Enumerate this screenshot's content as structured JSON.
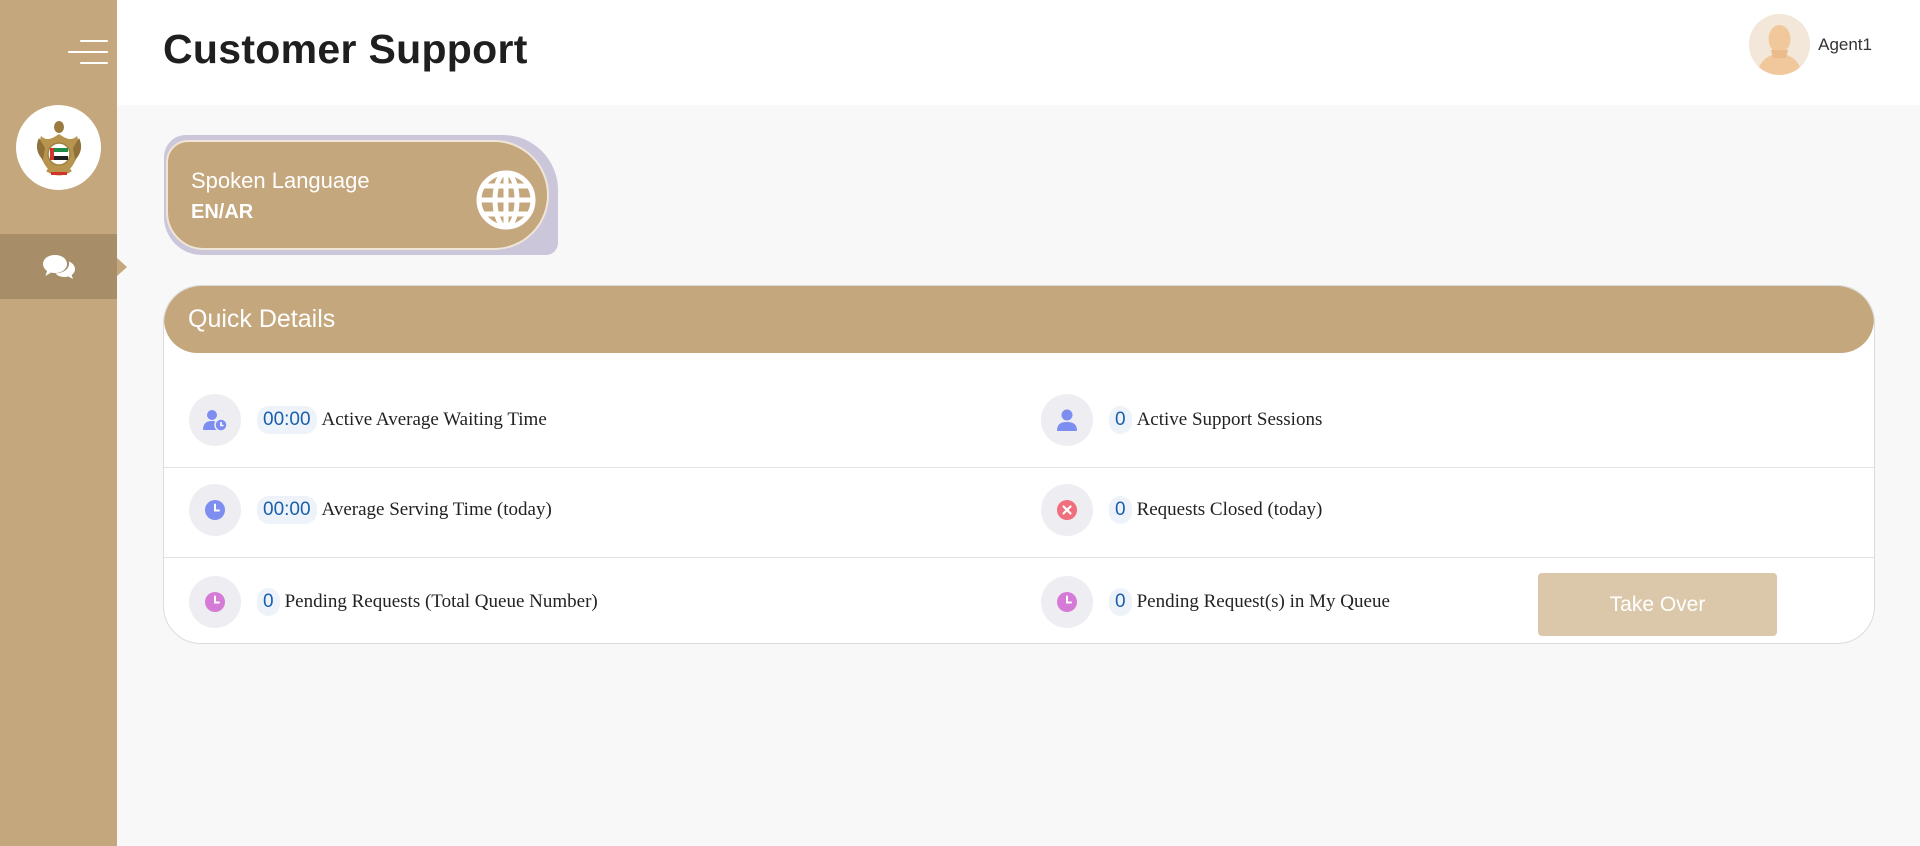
{
  "header": {
    "title": "Customer Support",
    "user_name": "Agent1"
  },
  "sidebar": {
    "items": [
      {
        "icon": "chat-bubbles-icon",
        "active": true
      }
    ]
  },
  "language_card": {
    "label": "Spoken Language",
    "value": "EN/AR"
  },
  "quick_details": {
    "title": "Quick Details",
    "stats": [
      {
        "value": "00:00",
        "label": "Active Average Waiting Time",
        "icon": "user-clock-icon",
        "icon_color": "#7d8ef0"
      },
      {
        "value": "0",
        "label": "Active Support Sessions",
        "icon": "user-icon",
        "icon_color": "#7d8ef0"
      },
      {
        "value": "00:00",
        "label": "Average Serving Time (today)",
        "icon": "clock-icon",
        "icon_color": "#7d8ef0"
      },
      {
        "value": "0",
        "label": "Requests Closed (today)",
        "icon": "close-circle-icon",
        "icon_color": "#ef6f7f"
      },
      {
        "value": "0",
        "label": "Pending Requests (Total Queue Number)",
        "icon": "clock-icon",
        "icon_color": "#d67ad8"
      },
      {
        "value": "0",
        "label": "Pending Request(s) in My Queue",
        "icon": "clock-icon",
        "icon_color": "#d67ad8"
      }
    ],
    "take_over_label": "Take Over"
  },
  "colors": {
    "brand": "#c4a77d",
    "brand_dark": "#a88e68",
    "value_text": "#1a5fae"
  }
}
